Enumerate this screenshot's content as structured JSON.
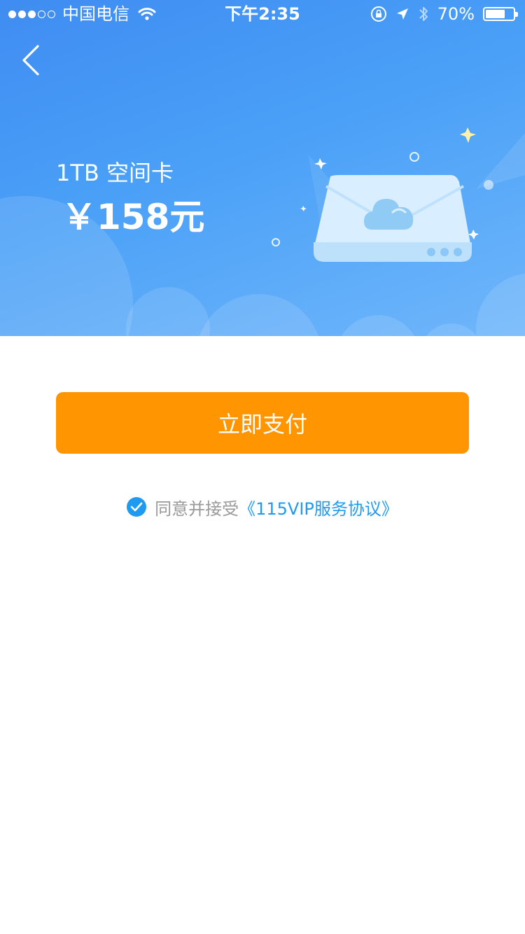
{
  "status_bar": {
    "carrier": "中国电信",
    "time": "下午2:35",
    "battery_text": "70%",
    "battery_level": 0.7,
    "signal_bars_filled": 3,
    "signal_bars_total": 5
  },
  "product": {
    "name": "1TB 空间卡",
    "price": "￥158元"
  },
  "pay_button": {
    "label": "立即支付"
  },
  "agreement": {
    "checked": true,
    "text": "同意并接受",
    "link": "《115VIP服务协议》"
  },
  "colors": {
    "hero_gradient_start": "#3f8cf2",
    "hero_gradient_end": "#6fb6fb",
    "pay_button": "#ff9500",
    "link": "#1e9bf0",
    "muted_text": "#999999"
  },
  "icons": [
    "signal-dots-icon",
    "wifi-icon",
    "lock-rotation-icon",
    "location-arrow-icon",
    "bluetooth-icon",
    "battery-icon",
    "back-chevron-icon",
    "cloud-drive-illustration",
    "checkmark-icon"
  ]
}
